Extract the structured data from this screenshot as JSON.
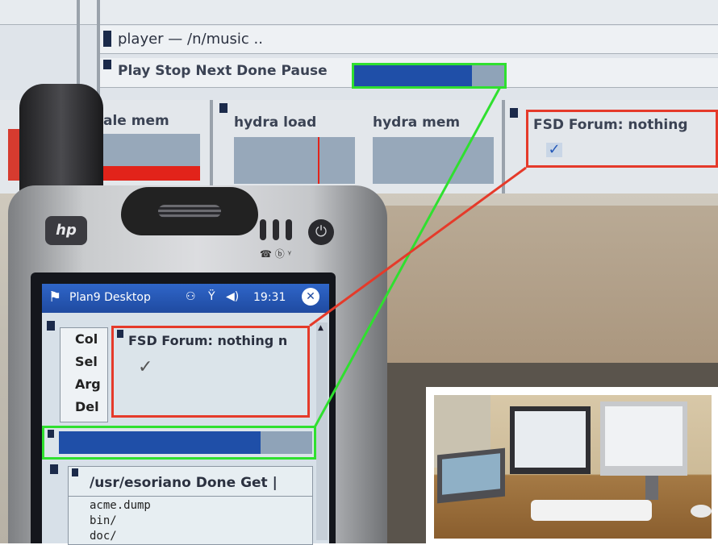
{
  "monitor": {
    "player_title": "player — /n/music ..",
    "player_controls": "Play Stop Next Done Pause",
    "panels": [
      {
        "label": "ale mem"
      },
      {
        "label": "hydra load"
      },
      {
        "label": "hydra mem"
      },
      {
        "label": "FSD Forum: nothing"
      }
    ]
  },
  "pda": {
    "brand": "hp",
    "titlebar": {
      "app": "Plan9 Desktop",
      "time": "19:31"
    },
    "left_menu": [
      "Col",
      "Sel",
      "Arg",
      "Del"
    ],
    "forum_title": "FSD Forum: nothing n",
    "checkmark": "✓",
    "file_window": {
      "title": "/usr/esoriano Done Get |",
      "lines": [
        "acme.dump",
        "bin/",
        "doc/"
      ]
    }
  },
  "callouts": {
    "green": "#2fe02f",
    "red": "#e53a2a"
  }
}
